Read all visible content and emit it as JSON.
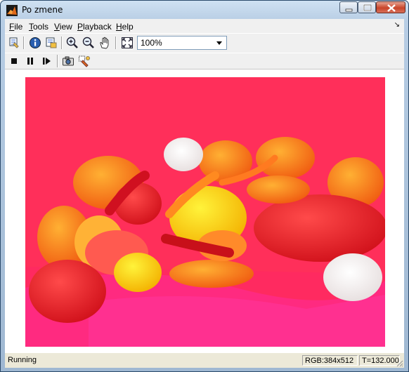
{
  "window": {
    "title": "Po zmene"
  },
  "menu": [
    {
      "label": "File",
      "key": "F",
      "rest": "ile"
    },
    {
      "label": "Tools",
      "key": "T",
      "rest": "ools"
    },
    {
      "label": "View",
      "key": "V",
      "rest": "iew"
    },
    {
      "label": "Playback",
      "key": "P",
      "rest": "layback"
    },
    {
      "label": "Help",
      "key": "H",
      "rest": "elp"
    }
  ],
  "toolbar": {
    "zoom_value": "100%",
    "icons": [
      "print-icon",
      "info-icon",
      "export-icon",
      "zoom-in-icon",
      "zoom-out-icon",
      "pan-hand-icon",
      "fit-to-window-icon",
      "stop-icon",
      "pause-icon",
      "step-forward-icon",
      "snapshot-icon",
      "highlight-icon"
    ]
  },
  "status": {
    "state": "Running",
    "format": "RGB:384x512",
    "time": "T=132.000"
  },
  "image": {
    "subject": "peppers and garlic with red-magenta tint"
  },
  "colors": {
    "tint": "#ff2a66",
    "window_chrome": "#b7cde4"
  }
}
